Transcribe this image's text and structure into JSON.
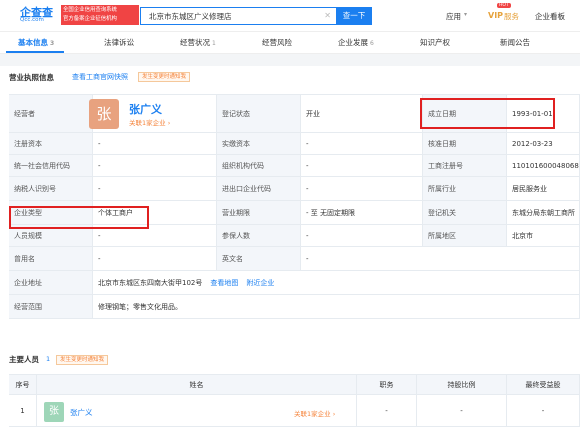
{
  "header": {
    "logo_text": "企查查",
    "logo_url": "Qcc.com",
    "slogan_line1": "全国企业信用查询系统",
    "slogan_line2": "官方备案企业征信机构",
    "search_value": "北京市东城区广义修理店",
    "search_clear": "✕",
    "search_button": "查一下",
    "nav_app": "应用",
    "hot_badge": "HOT",
    "vip": "VIP",
    "vip_service": "服务",
    "workbench": "企业看板"
  },
  "tabs": [
    {
      "label": "基本信息",
      "count": "3"
    },
    {
      "label": "法律诉讼",
      "count": ""
    },
    {
      "label": "经营状况",
      "count": "1"
    },
    {
      "label": "经营风险",
      "count": ""
    },
    {
      "label": "企业发展",
      "count": "6"
    },
    {
      "label": "知识产权",
      "count": ""
    },
    {
      "label": "新闻公告",
      "count": ""
    }
  ],
  "license": {
    "title": "营业执照信息",
    "link": "查看工商官网快照",
    "notice": "发生变更时通知我"
  },
  "person": {
    "avatar": "张",
    "name": "张广义",
    "link": "关联1家企业 ›"
  },
  "rows": {
    "r1": {
      "l1": "经营者",
      "l3": "登记状态",
      "v3": "开业",
      "l5": "成立日期",
      "v5": "1993-01-01"
    },
    "r2": {
      "l1": "注册资本",
      "v1": "-",
      "l3": "实缴资本",
      "v3": "-",
      "l5": "核准日期",
      "v5": "2012-03-23"
    },
    "r3": {
      "l1": "统一社会信用代码",
      "v1": "-",
      "l3": "组织机构代码",
      "v3": "-",
      "l5": "工商注册号",
      "v5": "110101600048068"
    },
    "r4": {
      "l1": "纳税人识别号",
      "v1": "-",
      "l3": "进出口企业代码",
      "v3": "-",
      "l5": "所属行业",
      "v5": "居民服务业"
    },
    "r5": {
      "l1": "企业类型",
      "v1": "个体工商户",
      "l3": "营业期限",
      "v3": "- 至 无固定期限",
      "l5": "登记机关",
      "v5": "东城分局东朝工商所"
    },
    "r6": {
      "l1": "人员规模",
      "v1": "-",
      "l3": "参保人数",
      "v3": "-",
      "l5": "所属地区",
      "v5": "北京市"
    },
    "r7": {
      "l1": "曾用名",
      "v1": "-",
      "l3": "英文名",
      "v3": "-"
    },
    "r8": {
      "l1": "企业地址",
      "v1": "北京市东城区东四南大街甲102号",
      "map": "查看地图",
      "nearby": "附近企业"
    },
    "r9": {
      "l1": "经营范围",
      "v1": "修理钢笔；零售文化用品。"
    }
  },
  "personnel": {
    "title": "主要人员",
    "count": "1",
    "notice": "发生变更时通知我",
    "headers": [
      "序号",
      "姓名",
      "职务",
      "持股比例",
      "最终受益股"
    ],
    "row": {
      "no": "1",
      "avatar": "张",
      "name": "张广义",
      "link": "关联1家企业 ›",
      "role": "-",
      "share": "-",
      "benefit": "-"
    }
  },
  "colors": {
    "accent": "#1b7ff0",
    "highlight": "#e02020",
    "orange": "#f5843c"
  }
}
